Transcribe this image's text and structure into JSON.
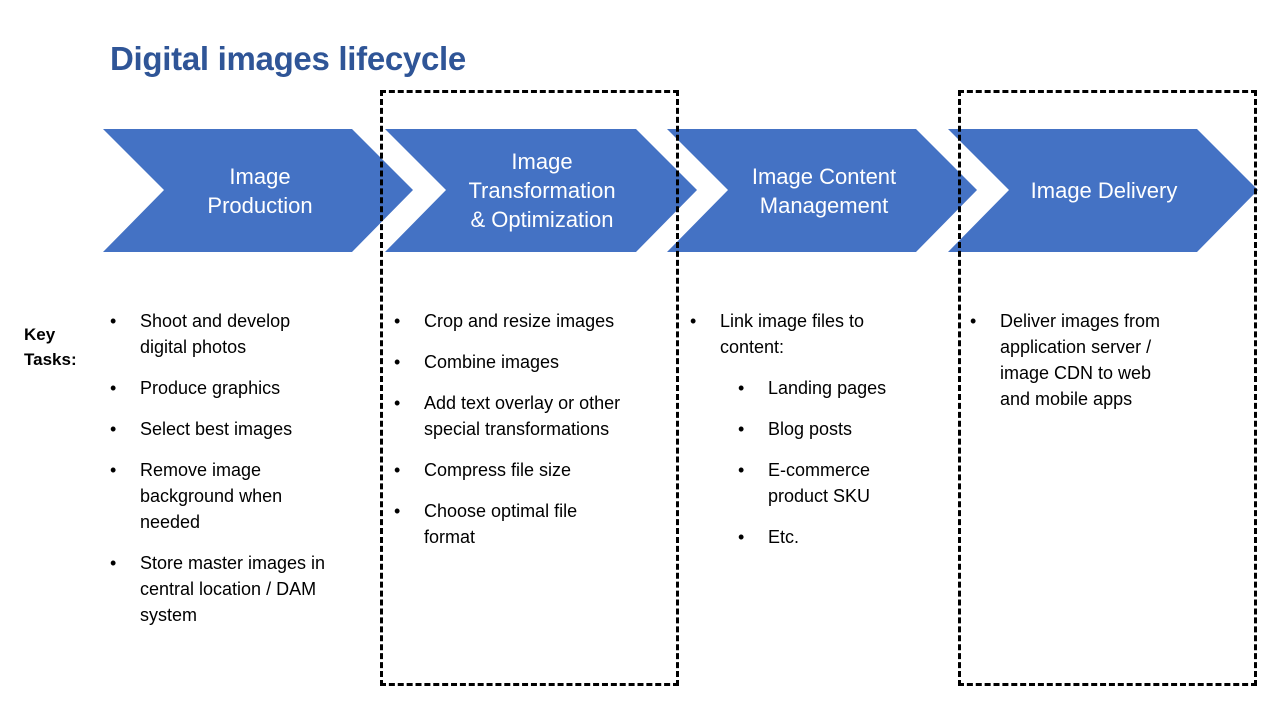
{
  "title": "Digital images lifecycle",
  "colors": {
    "title": "#2f5597",
    "chevron_fill": "#4472c4",
    "chevron_text": "#ffffff",
    "dash_border": "#000000"
  },
  "key_tasks_label": [
    "Key",
    "Tasks:"
  ],
  "stages": [
    {
      "label": "Image Production",
      "label_lines": [
        "Image",
        "Production"
      ],
      "highlighted": false,
      "tasks": [
        {
          "text": "Shoot and develop digital photos",
          "level": 1
        },
        {
          "text": "Produce graphics",
          "level": 1
        },
        {
          "text": "Select best images",
          "level": 1
        },
        {
          "text": "Remove image background when needed",
          "level": 1
        },
        {
          "text": "Store master images in central location / DAM system",
          "level": 1
        }
      ]
    },
    {
      "label": "Image Transformation & Optimization",
      "label_lines": [
        "Image",
        "Transformation",
        "& Optimization"
      ],
      "highlighted": true,
      "tasks": [
        {
          "text": "Crop and resize images",
          "level": 1
        },
        {
          "text": "Combine images",
          "level": 1
        },
        {
          "text": "Add text overlay or other special transformations",
          "level": 1
        },
        {
          "text": "Compress file size",
          "level": 1
        },
        {
          "text": "Choose optimal file format",
          "level": 1
        }
      ]
    },
    {
      "label": "Image Content Management",
      "label_lines": [
        "Image Content",
        "Management"
      ],
      "highlighted": false,
      "tasks": [
        {
          "text": "Link image files to content:",
          "level": 1
        },
        {
          "text": "Landing pages",
          "level": 2
        },
        {
          "text": "Blog posts",
          "level": 2
        },
        {
          "text": "E-commerce product SKU",
          "level": 2
        },
        {
          "text": "Etc.",
          "level": 2
        }
      ]
    },
    {
      "label": "Image Delivery",
      "label_lines": [
        "Image Delivery"
      ],
      "highlighted": true,
      "tasks": [
        {
          "text": "Deliver images from application server / image CDN to web and mobile apps",
          "level": 1
        }
      ]
    }
  ]
}
